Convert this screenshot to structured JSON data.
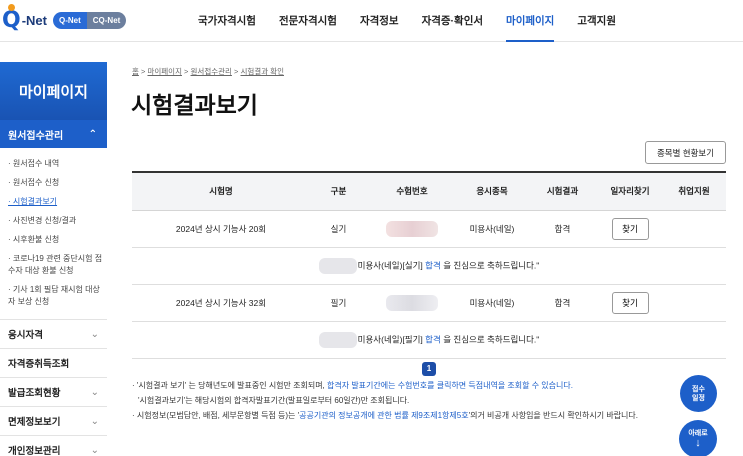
{
  "header": {
    "logo": {
      "q": "Q",
      "net": "-Net",
      "pill_a": "Q-Net",
      "pill_b": "CQ-Net"
    },
    "nav": [
      "국가자격시험",
      "전문자격시험",
      "자격정보",
      "자격증·확인서",
      "마이페이지",
      "고객지원"
    ],
    "active_nav": "마이페이지"
  },
  "sidebar": {
    "title": "마이페이지",
    "category": "원서접수관리",
    "sub_items": [
      "· 원서접수 내역",
      "· 원서접수 신청",
      "· 시험결과보기",
      "· 사진변경 신청/결과",
      "· 시후환불 신청",
      "· 코로나19 관련 중단시험 접수자 대상 환불 신청",
      "· 기사 1회 필답 재시험 대상자 보상 신청"
    ],
    "current_sub": "· 시험결과보기",
    "menus": [
      "응시자격",
      "자격증취득조회",
      "발급조회현황",
      "면제정보보기",
      "개인정보관리"
    ]
  },
  "breadcrumb": {
    "home": "홈",
    "sep": " > ",
    "items": [
      "마이페이지",
      "원서접수관리",
      "시험결과 확인"
    ]
  },
  "page_title": "시험결과보기",
  "stat_button": "종목별 현황보기",
  "table": {
    "headers": [
      "시험명",
      "구분",
      "수험번호",
      "응시종목",
      "시험결과",
      "일자리찾기",
      "취업지원"
    ],
    "rows": [
      {
        "exam": "2024년 상시 기능사 20회",
        "type": "실기",
        "subject": "미용사(네일)",
        "result": "합격",
        "find": "찾기",
        "msg_pre": "미용사(네일)[실기]",
        "msg_pass": "합격",
        "msg_post": "을 진심으로 축하드립니다.\""
      },
      {
        "exam": "2024년 상시 기능사 32회",
        "type": "필기",
        "subject": "미용사(네일)",
        "result": "합격",
        "find": "찾기",
        "msg_pre": "미용사(네일)[필기]",
        "msg_pass": "합격",
        "msg_post": "을 진심으로 축하드립니다.\""
      }
    ]
  },
  "pagination": {
    "current": "1"
  },
  "notes": {
    "n1_a": "· '시험결과 보기' 는 당해년도에 발표중인 시험만 조회되며, ",
    "n1_b": "합격자 발표기간에는 수험번호를 클릭하면 득점내역을 조회할 수 있습니다.",
    "n2": "'시험결과보기'는 해당시험의 합격자발표기간(발표일로부터 60일간)만 조회됩니다.",
    "n3_a": "· 시험정보(모범답안, 배점, 세부문항별 득점 등)는 '",
    "n3_b": "공공기관의 정보공개에 관한 법률 제9조제1항제5호",
    "n3_c": "'의거 비공개 사항임을 반드시 확인하시기 바랍니다."
  },
  "fab": {
    "schedule_1": "접수",
    "schedule_2": "일정",
    "down": "아래로",
    "down_icon": "arrow-down-icon"
  },
  "colors": {
    "primary": "#1d5fc9",
    "accent": "#f29b1d"
  }
}
